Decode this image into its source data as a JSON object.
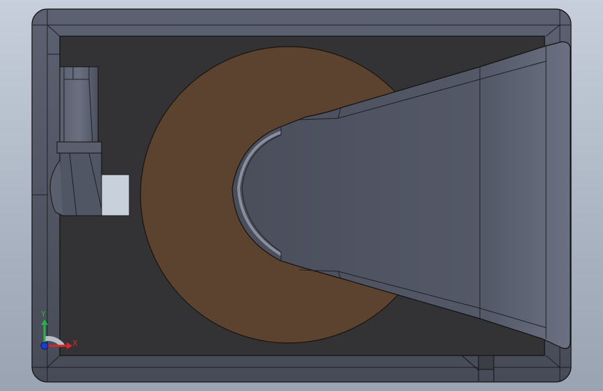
{
  "view": {
    "background_top": "#c6cfdb",
    "background_bottom": "#9aa3b2"
  },
  "model": {
    "housing_color": "#4e5361",
    "cavity_color": "#333335",
    "disc_color": "#5b4330",
    "arm_color": "#4a4e5b",
    "block_color": "#c8d0dc"
  },
  "triad": {
    "x_label": "X",
    "y_label": "Y",
    "x_color": "#d22a2a",
    "y_color": "#2ab04a",
    "z_color": "#1e3ccc"
  }
}
